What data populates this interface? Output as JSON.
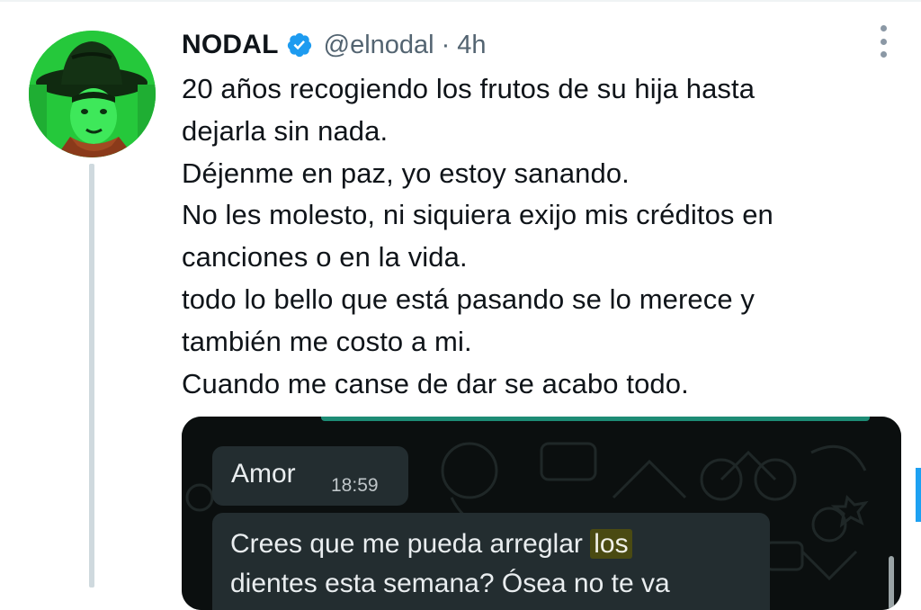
{
  "author": {
    "name": "NODAL",
    "handle": "@elnodal",
    "separator": "·",
    "time": "4h",
    "verified": true,
    "avatar_icon": "cowboy-child-avatar"
  },
  "tweet": {
    "lines": [
      "20 años recogiendo los frutos de su hija hasta",
      "dejarla sin nada.",
      "Déjenme en paz, yo estoy sanando.",
      "No les molesto, ni siquiera exijo mis créditos en",
      "canciones o en la vida.",
      "todo lo bello que está pasando se lo merece y",
      "también me costo a mi.",
      "Cuando me canse de dar se acabo todo."
    ]
  },
  "media": {
    "message1": {
      "text": "Amor",
      "time": "18:59"
    },
    "message2": {
      "line1_before": "Crees que me pueda arreglar ",
      "line1_highlight": "los",
      "line2": "dientes esta semana? Ósea no te va"
    }
  },
  "colors": {
    "verified_blue": "#1d9bf0",
    "avatar_green": "#23c93a",
    "bubble_dark": "#232d30",
    "chat_bg": "#0b0f0f"
  }
}
